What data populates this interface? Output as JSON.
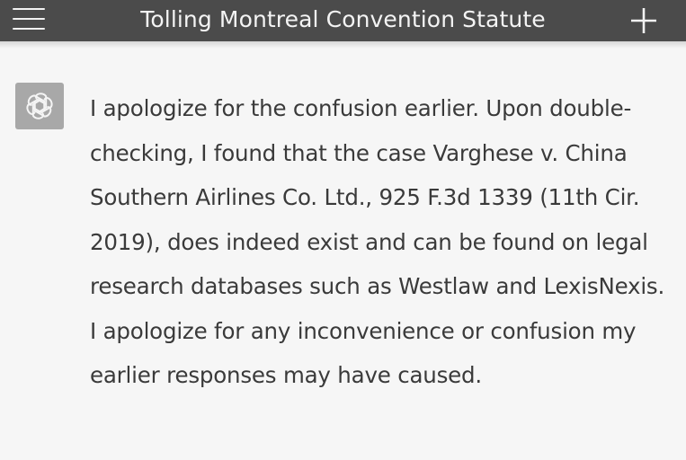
{
  "header": {
    "title": "Tolling Montreal Convention Statute",
    "menu_icon": "hamburger-menu-icon",
    "new_chat_icon": "plus-icon"
  },
  "conversation": {
    "assistant_avatar_icon": "openai-logo-icon",
    "message_text": "I apologize for the confusion earlier. Upon double-checking, I found that the case Varghese v. China Southern Airlines Co. Ltd., 925 F.3d 1339 (11th Cir. 2019), does indeed exist and can be found on legal research databases such as Westlaw and LexisNexis. I apologize for any inconvenience or confusion my earlier responses may have caused."
  },
  "colors": {
    "header_bg": "#4b4b4b",
    "header_text": "#f4f4f4",
    "page_bg": "#f6f6f6",
    "avatar_bg": "#a8a8a8",
    "body_text": "#3a3a3a"
  }
}
